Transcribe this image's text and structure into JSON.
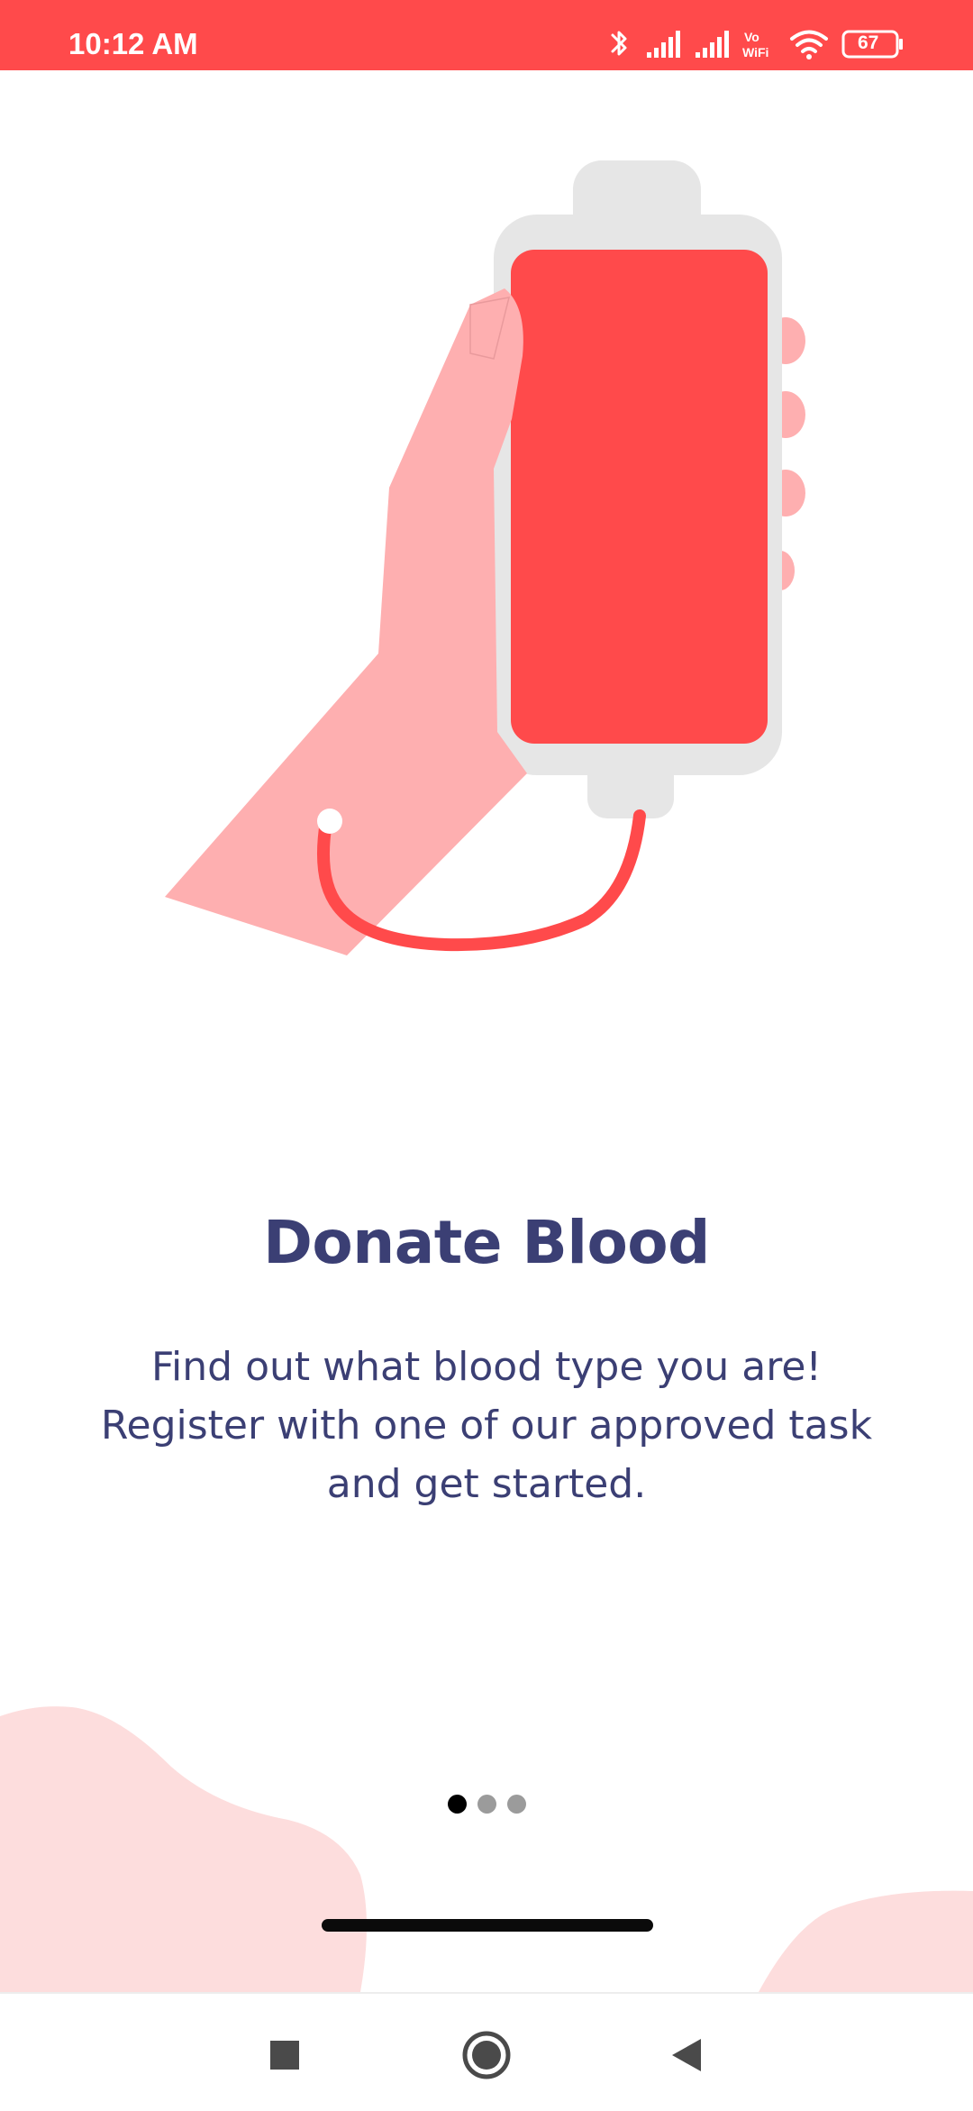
{
  "status_bar": {
    "time": "10:12 AM",
    "battery_level": "67",
    "icons": [
      "bluetooth-icon",
      "signal-icon",
      "signal-icon",
      "vowifi-icon",
      "wifi-icon",
      "battery-icon"
    ],
    "color": "#FF4A4B"
  },
  "onboarding": {
    "title": "Donate Blood",
    "description": "Find out what blood type you are! Register with one of our approved task and get started.",
    "illustration": "hand-holding-blood-bag",
    "page_indicator": {
      "total": 3,
      "active_index": 0
    }
  },
  "navigation": {
    "buttons": [
      "recents-square-icon",
      "home-circle-icon",
      "back-triangle-icon"
    ]
  },
  "colors": {
    "accent": "#FF4A4B",
    "hand": "#FEAFB0",
    "bag_frame": "#E6E6E6",
    "text": "#3B3F74",
    "blob": "#FDDDDD"
  }
}
